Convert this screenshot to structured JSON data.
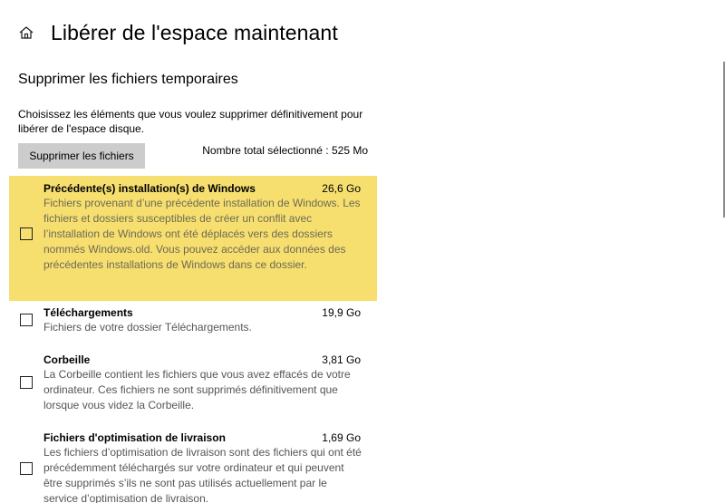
{
  "header": {
    "icon": "home-icon",
    "title": "Libérer de l'espace maintenant"
  },
  "section": {
    "title": "Supprimer les fichiers temporaires",
    "description": "Choisissez les éléments que vous voulez supprimer définitivement pour libérer de l'espace disque."
  },
  "actions": {
    "delete_label": "Supprimer les fichiers",
    "total_selected": "Nombre total sélectionné : 525 Mo"
  },
  "items": [
    {
      "name": "Précédente(s) installation(s) de Windows",
      "size": "26,6 Go",
      "description": "Fichiers provenant d’une précédente installation de Windows. Les fichiers et dossiers susceptibles de créer un conflit avec l’installation de Windows ont été déplacés vers des dossiers nommés Windows.old. Vous pouvez accéder aux données des précédentes installations de Windows dans ce dossier.",
      "checked": false,
      "highlighted": true
    },
    {
      "name": "Téléchargements",
      "size": "19,9 Go",
      "description": "Fichiers de votre dossier Téléchargements.",
      "checked": false,
      "highlighted": false
    },
    {
      "name": "Corbeille",
      "size": "3,81 Go",
      "description": "La Corbeille contient les fichiers que vous avez effacés de votre ordinateur. Ces fichiers ne sont supprimés définitivement que lorsque vous videz la Corbeille.",
      "checked": false,
      "highlighted": false
    },
    {
      "name": "Fichiers d'optimisation de livraison",
      "size": "1,69 Go",
      "description": "Les fichiers d’optimisation de livraison sont des fichiers qui ont été précédemment téléchargés sur votre ordinateur et qui peuvent être supprimés s’ils ne sont pas utilisés actuellement par le service d’optimisation de livraison.",
      "checked": false,
      "highlighted": false
    }
  ],
  "colors": {
    "highlight": "#f6df6f",
    "button": "#cccccc"
  }
}
